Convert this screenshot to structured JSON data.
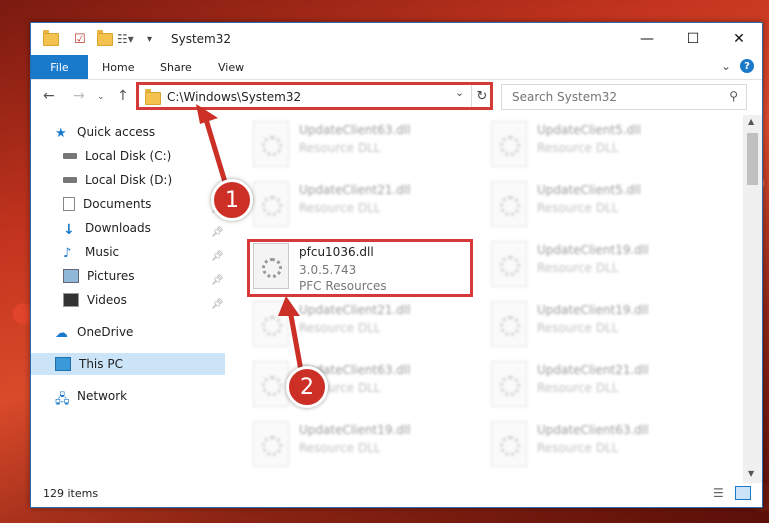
{
  "window": {
    "title": "System32",
    "controls": {
      "minimize": "—",
      "maximize": "☐",
      "close": "✕"
    }
  },
  "ribbon": {
    "file": "File",
    "tabs": [
      "Home",
      "Share",
      "View"
    ]
  },
  "address": {
    "path": "C:\\Windows\\System32",
    "search_placeholder": "Search System32"
  },
  "nav": {
    "items": [
      {
        "label": "Quick access",
        "icon": "star-icon"
      },
      {
        "label": "Local Disk (C:)",
        "icon": "drive-icon",
        "pinned": true
      },
      {
        "label": "Local Disk (D:)",
        "icon": "drive-icon",
        "pinned": true
      },
      {
        "label": "Documents",
        "icon": "document-icon",
        "pinned": true
      },
      {
        "label": "Downloads",
        "icon": "download-icon",
        "pinned": true
      },
      {
        "label": "Music",
        "icon": "music-icon",
        "pinned": true
      },
      {
        "label": "Pictures",
        "icon": "pictures-icon",
        "pinned": true
      },
      {
        "label": "Videos",
        "icon": "video-icon",
        "pinned": true
      },
      {
        "label": "OneDrive",
        "icon": "cloud-icon"
      },
      {
        "label": "This PC",
        "icon": "computer-icon",
        "selected": true
      },
      {
        "label": "Network",
        "icon": "network-icon"
      }
    ]
  },
  "files": {
    "left": [
      {
        "name": "UpdateClient63.dll",
        "desc": "Resource DLL"
      },
      {
        "name": "UpdateClient21.dll",
        "desc": "Resource DLL"
      },
      {
        "name": "pfcu1036.dll",
        "version": "3.0.5.743",
        "desc": "PFC Resources",
        "highlight": true
      },
      {
        "name": "UpdateClient21.dll",
        "desc": "Resource DLL"
      },
      {
        "name": "UpdateClient63.dll",
        "desc": "Resource DLL"
      },
      {
        "name": "UpdateClient19.dll",
        "desc": "Resource DLL"
      }
    ],
    "right": [
      {
        "name": "UpdateClient5.dll",
        "desc": "Resource DLL"
      },
      {
        "name": "UpdateClient5.dll",
        "desc": "Resource DLL"
      },
      {
        "name": "UpdateClient19.dll",
        "desc": "Resource DLL"
      },
      {
        "name": "UpdateClient19.dll",
        "desc": "Resource DLL"
      },
      {
        "name": "UpdateClient21.dll",
        "desc": "Resource DLL"
      },
      {
        "name": "UpdateClient63.dll",
        "desc": "Resource DLL"
      }
    ]
  },
  "status": {
    "count": "129 items"
  },
  "callouts": [
    "1",
    "2"
  ],
  "colors": {
    "accent": "#1979ca",
    "highlight": "#d6393a",
    "callout": "#cc2f26"
  }
}
